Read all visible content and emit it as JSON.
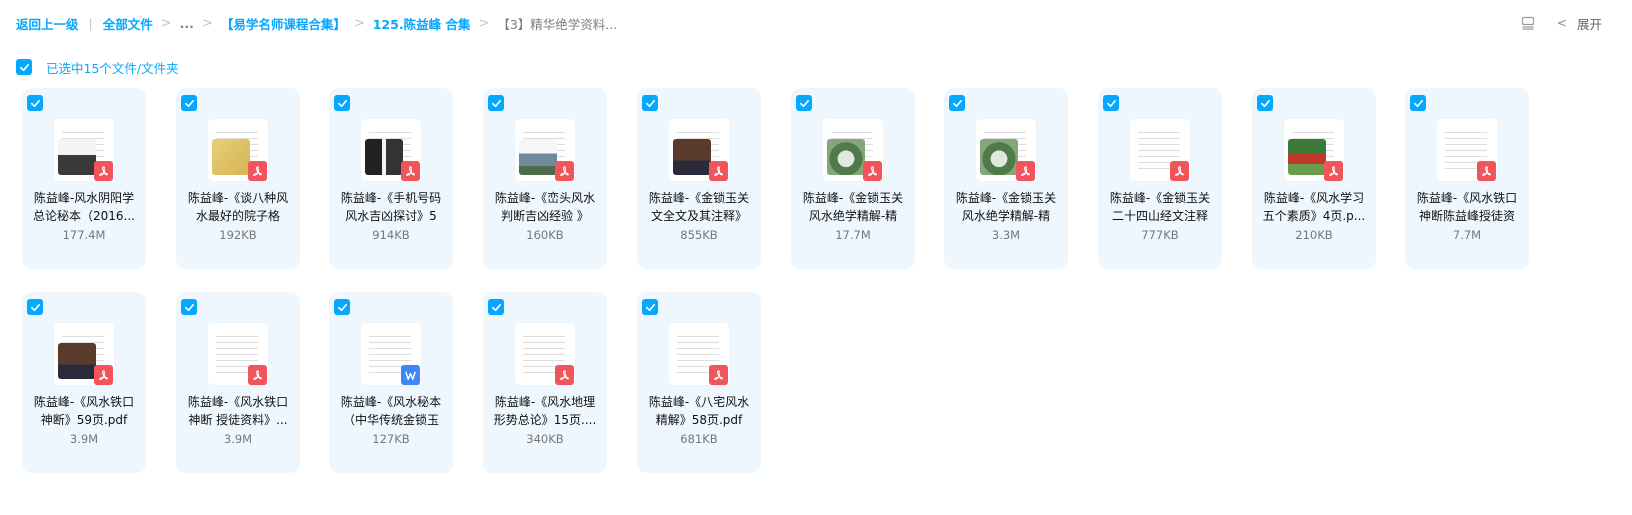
{
  "breadcrumb": {
    "back": "返回上一级",
    "bar": "|",
    "all_files": "全部文件",
    "sep": ">",
    "ellipsis": "...",
    "folder1": "【易学名师课程合集】",
    "folder2": "125.陈益峰 合集",
    "current": "【3】精华绝学资料..."
  },
  "top_right": {
    "layout_icon": "list-layout-icon",
    "expand_chevron": "<",
    "expand_label": "展开"
  },
  "selection": {
    "summary": "已选中15个文件/文件夹"
  },
  "colors": {
    "accent": "#06a7ff",
    "tile_bg": "#eef7fe",
    "pdf_badge": "#f2545b",
    "doc_badge": "#3e87f5"
  },
  "files": [
    {
      "name": "陈益峰-风水阴阳学总论秘本（2016...",
      "size": "177.4M",
      "type": "pdf",
      "thumb": "photo-dark"
    },
    {
      "name": "陈益峰-《谈八种风水最好的院子格",
      "size": "192KB",
      "type": "pdf",
      "thumb": "photo-yellow"
    },
    {
      "name": "陈益峰-《手机号码风水吉凶探讨》5",
      "size": "914KB",
      "type": "pdf",
      "thumb": "photo-phone"
    },
    {
      "name": "陈益峰-《峦头风水判断吉凶经验 》",
      "size": "160KB",
      "type": "pdf",
      "thumb": "photo-mountain"
    },
    {
      "name": "陈益峰-《金锁玉关文全文及其注释》",
      "size": "855KB",
      "type": "pdf",
      "thumb": "photo-portrait"
    },
    {
      "name": "陈益峰-《金锁玉关风水绝学精解-精",
      "size": "17.7M",
      "type": "pdf",
      "thumb": "photo-green"
    },
    {
      "name": "陈益峰-《金锁玉关风水绝学精解-精",
      "size": "3.3M",
      "type": "pdf",
      "thumb": "photo-green"
    },
    {
      "name": "陈益峰-《金锁玉关二十四山经文注释",
      "size": "777KB",
      "type": "pdf",
      "thumb": "text"
    },
    {
      "name": "陈益峰-《风水学习五个素质》4页.p...",
      "size": "210KB",
      "type": "pdf",
      "thumb": "photo-red"
    },
    {
      "name": "陈益峰-《风水铁口神断陈益峰授徒资",
      "size": "7.7M",
      "type": "pdf",
      "thumb": "text-doc"
    },
    {
      "name": "陈益峰-《风水铁口神断》59页.pdf",
      "size": "3.9M",
      "type": "pdf",
      "thumb": "photo-portrait"
    },
    {
      "name": "陈益峰-《风水铁口神断 授徒资料》...",
      "size": "3.9M",
      "type": "pdf",
      "thumb": "text"
    },
    {
      "name": "陈益峰-《风水秘本（中华传统金锁玉",
      "size": "127KB",
      "type": "doc",
      "thumb": "text"
    },
    {
      "name": "陈益峰-《风水地理形势总论》15页....",
      "size": "340KB",
      "type": "pdf",
      "thumb": "text"
    },
    {
      "name": "陈益峰-《八宅风水精解》58页.pdf",
      "size": "681KB",
      "type": "pdf",
      "thumb": "text-green"
    }
  ]
}
